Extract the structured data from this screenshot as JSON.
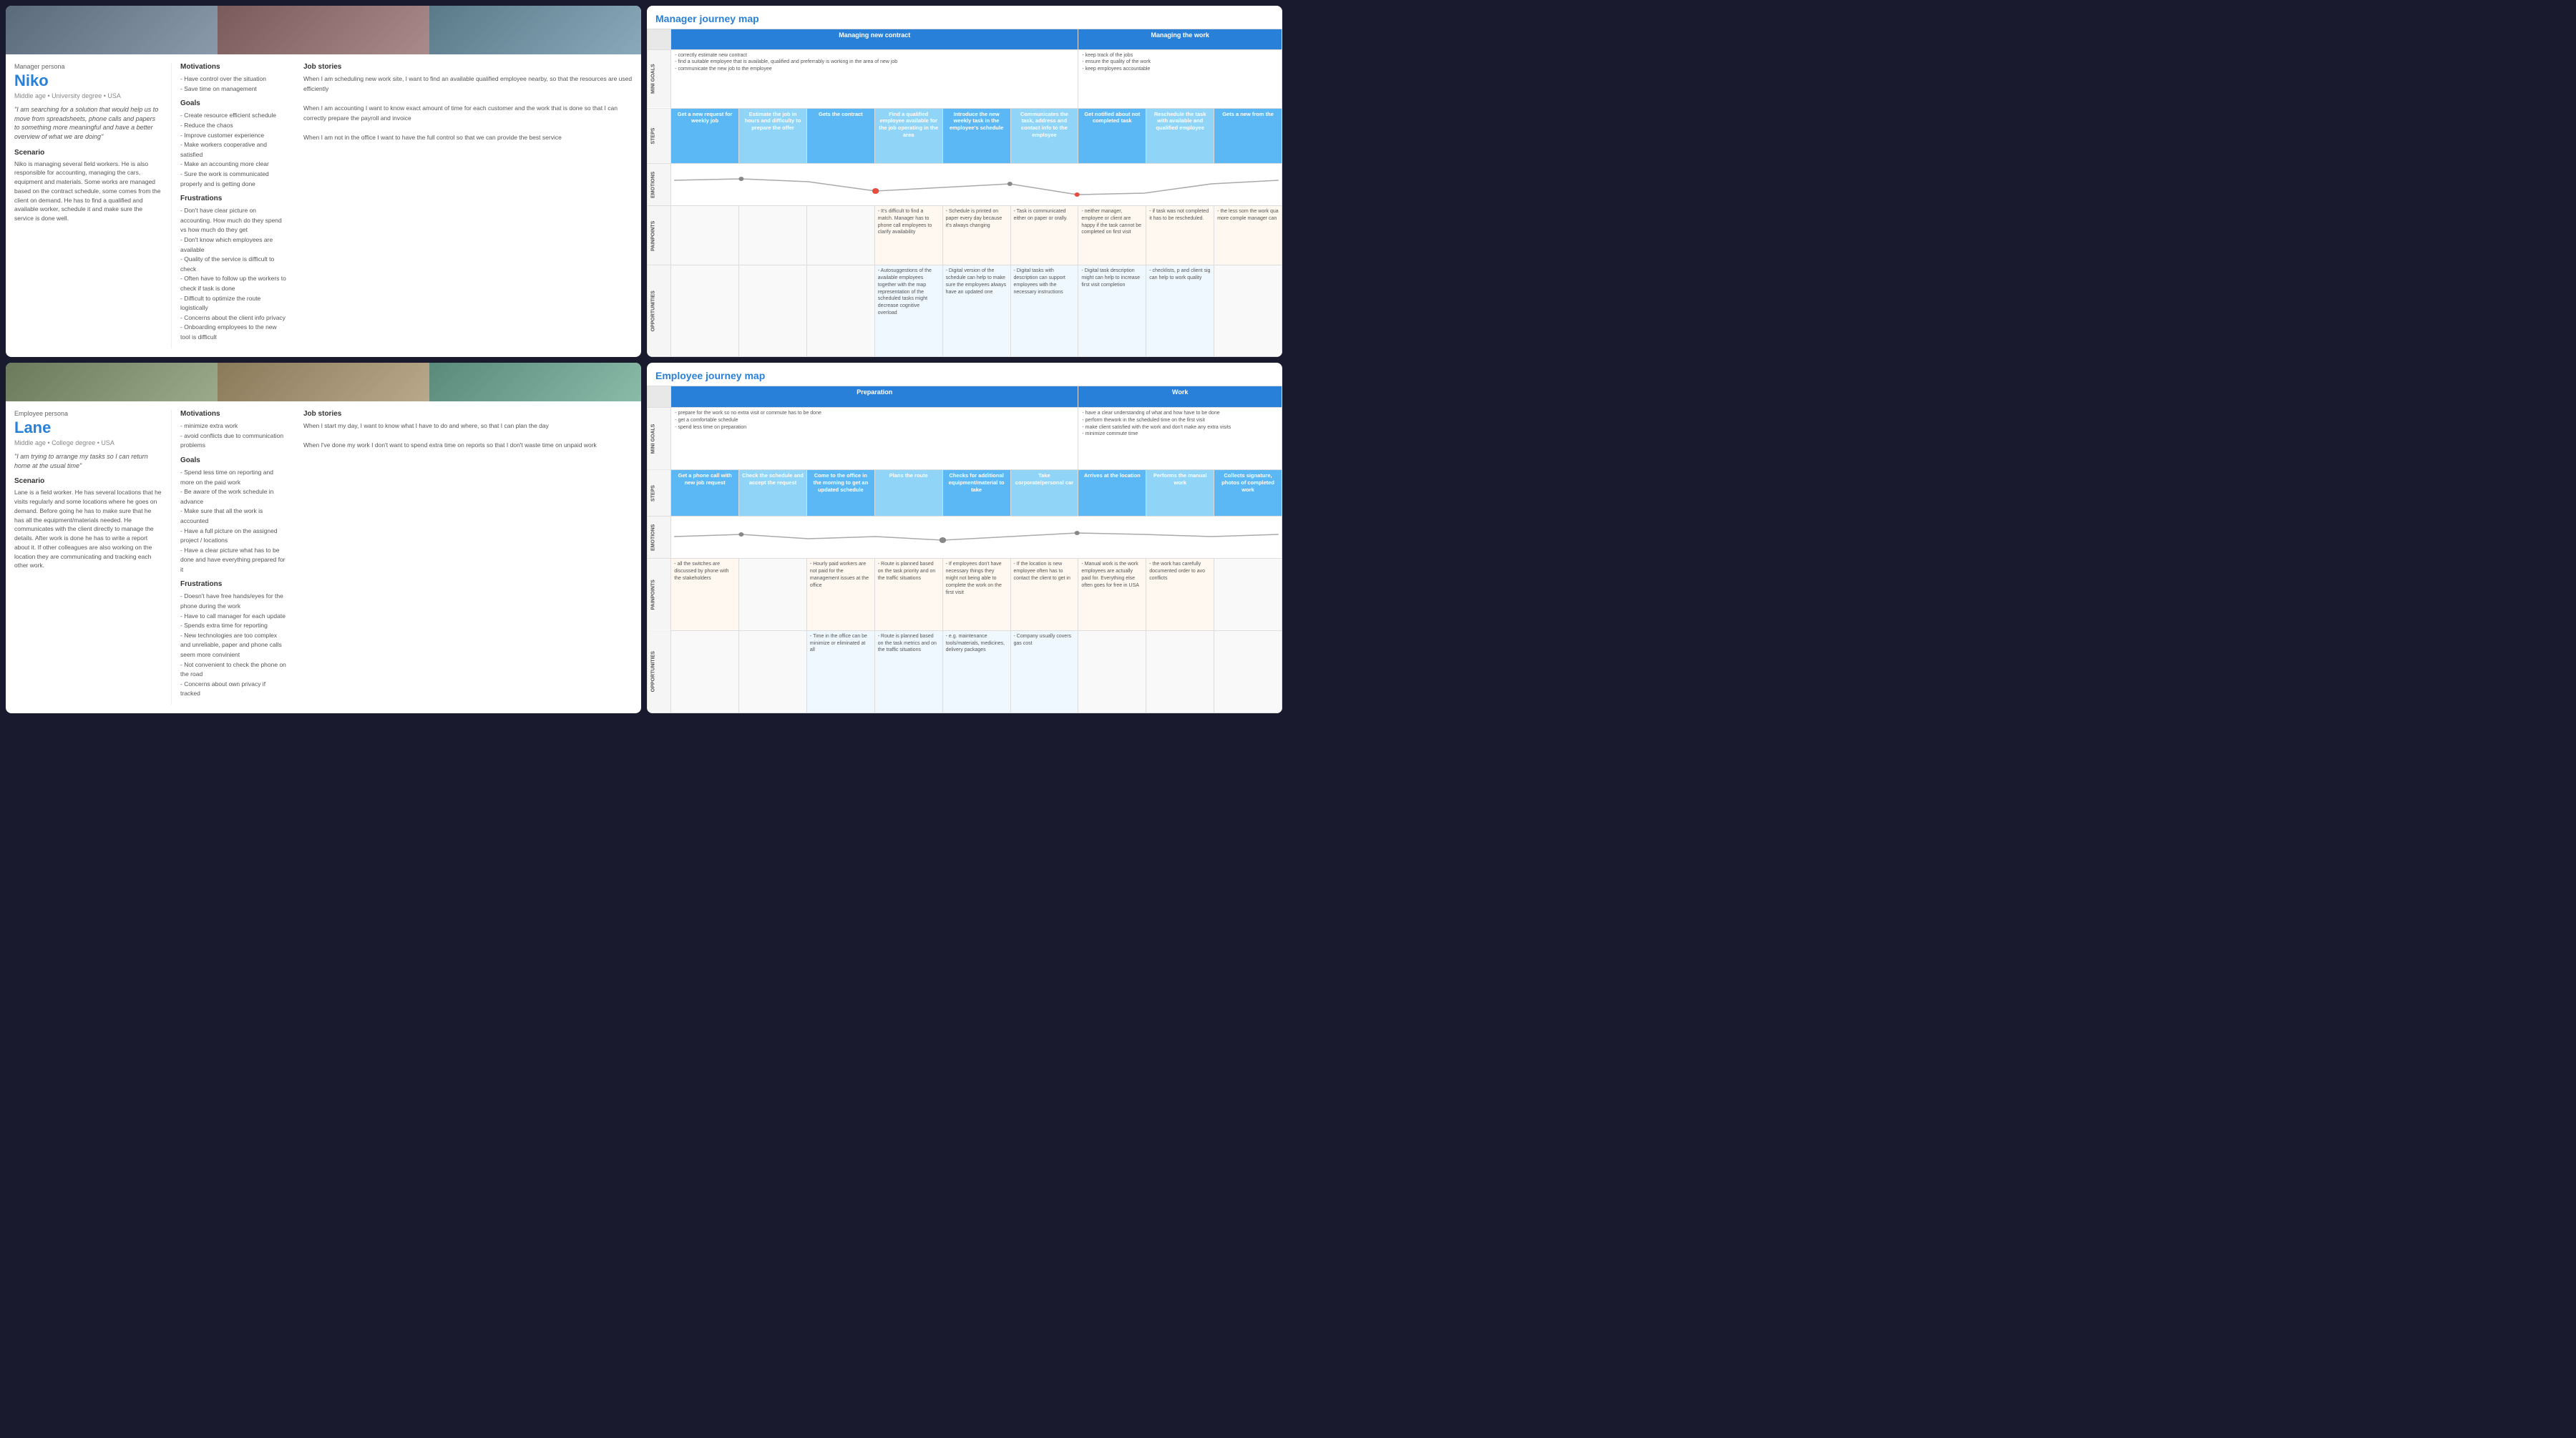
{
  "manager_persona": {
    "label": "Manager persona",
    "name": "Niko",
    "meta": "Middle age  •  University degree  •  USA",
    "quote": "\"I am searching for a solution that would help us to move from spreadsheets, phone calls and papers to something more meaningful and have a better overview of what we are doing\"",
    "scenario_title": "Scenario",
    "scenario_text": "Niko is managing several field workers. He is also responsible for accounting, managing the cars, equipment and materials. Some works are managed based on the contract schedule, some comes from the client on demand. He has to find a qualified and available worker, schedule it  and make sure the service is done well.",
    "motivations_title": "Motivations",
    "motivations": "- Have control over the situation\n- Save time on management",
    "goals_title": "Goals",
    "goals": "- Create resource efficient schedule\n- Reduce the chaos\n- Improve customer experience\n- Make workers cooperative and satisfied\n- Make an accounting more clear\n- Sure the work is communicated properly and is getting done",
    "frustrations_title": "Frustrations",
    "frustrations": "- Don't have clear picture on accounting. How much do they spend vs how much do they get\n- Don't know which employees are available\n- Quality of the service is difficult to check\n- Often have to follow up the workers to check if task is done\n- Difficult to optimize the route logistically\n- Concerns about the client info privacy\n- Onboarding employees to the new tool is difficult",
    "job_stories_title": "Job stories",
    "job_stories": "When I am scheduling new work site, I want to find an available qualified employee nearby, so that the resources are used efficiently\n\nWhen I am accounting I want to know exact amount of time for each customer and the work that is done so that I can correctly prepare the payroll and invoice\n\nWhen I am not in the office I want to have the full control so that we can provide the best service"
  },
  "employee_persona": {
    "label": "Employee persona",
    "name": "Lane",
    "meta": "Middle age  •  College degree  •  USA",
    "quote": "\"I am trying to arrange my tasks so I can return home at the usual time\"",
    "scenario_title": "Scenario",
    "scenario_text": "Lane is a field worker. He has several locations that he visits regularly and some locations where he goes on demand. Before going he has to make sure that he has all the equipment/materials needed. He communicates with the client directly to manage the details. After work is done he has to write a report about it. If other colleagues are also working on the location they are communicating and tracking each other work.",
    "motivations_title": "Motivations",
    "motivations": "- minimize extra work\n- avoid conflicts due to communication problems",
    "goals_title": "Goals",
    "goals": "- Spend less time on reporting and more on the paid work\n- Be aware of the work schedule in advance\n- Make sure that all the work is accounted\n- Have a full picture on the assigned project / locations\n- Have a clear picture what has to be done and have everything prepared for it",
    "frustrations_title": "Frustrations",
    "frustrations": "- Doesn't have free hands/eyes for the phone during the work\n- Have to call manager for each update\n- Spends extra time for reporting\n- New technologies are too complex and unreliable, paper and phone calls seem more convinient\n- Not convenient to check the phone on the road\n- Concerns about own privacy if tracked",
    "job_stories_title": "Job stories",
    "job_stories": "When I start my day, I want to know what I have to do and where, so that I can plan the day\n\nWhen I've done my work I don't want to spend extra time on reports so that I don't waste time on unpaid work"
  },
  "manager_journey": {
    "title": "Manager journey map",
    "phase1": "Managing new contract",
    "phase2": "Managing the work",
    "rows": {
      "mini_goals": "MINI GOALS",
      "steps": "STEPS",
      "emotions": "EMOTIONS",
      "painpoints": "PAINPOINTS",
      "opportunities": "OPPORTUNITIES"
    },
    "mini_goals_p1": "- correctly estimate new contract\n- find a suitable employee that is available, qualified and preferrably is working in the area of new job\n- communicate the new job to the employee",
    "mini_goals_p2": "- keep track of the jobs\n- ensure the quality of the work\n- keep employees accountable",
    "steps": [
      "Get a new request for weekly job",
      "Estimate the job in hours and difficulty to prepare the offer",
      "Gets the contract",
      "Find a qualified employee available for the job operating in the area",
      "Introduce the new weekly task in the employee's schedule",
      "Communicates the task, address and contact info to the employee",
      "Get notified about not completed task",
      "Reschedule the task with available and qualified employee",
      "Gets a new from the"
    ],
    "painpoints": [
      "",
      "",
      "",
      "- It's difficult to find a match. Manager has to phone call employees to clarify availability",
      "- Schedule is printed on paper every day because it's always changing",
      "- Task is communicated either on paper or orally.",
      "- neither manager, employee or client are happy if the task cannot be completed on first visit",
      "- if task was not completed it has to be rescheduled.",
      "- the less som the work qua more comple manager can"
    ],
    "opportunities": [
      "",
      "",
      "",
      "- Autosuggestions of the available employees together with the map representation of the scheduled tasks might decrease cognitive overload",
      "- Digital version of the schedule can help to make sure the employees always have an updated one",
      "- Digital tasks with description can support employees with the necessary instructions",
      "- Digital task description might can help to increase first visit completion",
      "- checklists, p and client sig can help to work quality"
    ]
  },
  "employee_journey": {
    "title": "Employee journey map",
    "phase1": "Preparation",
    "phase2": "Work",
    "rows": {
      "mini_goals": "MINI GOALS",
      "steps": "STEPS",
      "emotions": "EMOTIONS",
      "painpoints": "PAINPOINTS",
      "opportunities": "OPPORTUNITIES"
    },
    "mini_goals_p1": "- prepare for the work so no extra visit or commute has to be done\n- get a comfortable schedule\n- spend less time on preparation",
    "mini_goals_p2": "- have a clear understandng of what and how have to be done\n- perform thework in the scheduled time on the first visit\n- make client satisfied with the work and don't make any extra visits\n- minimize commute time",
    "steps": [
      "Get a phone call with new job request",
      "Check the schedule and accept the request",
      "Come to the office in the morning to get an updated schedule",
      "Plans the route",
      "Checks for additional equipment/material to take",
      "Take corporate/personal car",
      "Arrives at the location",
      "Performs the manual work",
      "Collects signature, photos of completed work (ap"
    ],
    "painpoints": [
      "- all the switches are discussed by phone with the stakeholders",
      "",
      "- Hourly paid workers are not paid for the management issues at the office",
      "- Route is planned based on the task priority and on the traffic situations",
      "- If employees don't have necessary things they might not being able to complete the work on the first visit",
      "- If the location is new employee often has to contact the client to get in",
      "- Manual work is the work employees are actually paid for. Everything else often goes for free in USA",
      "- the work has carefully documented order to avo conflicts"
    ],
    "opportunities": [
      "",
      "",
      "- Time in the office can be minimize or eliminated at all",
      "- Route is planned based on the task metrics and on the traffic situations",
      "- e.g. maintenance tools/materials, medicines, delivery packages",
      "- Company usually covers gas cost",
      "",
      ""
    ]
  }
}
